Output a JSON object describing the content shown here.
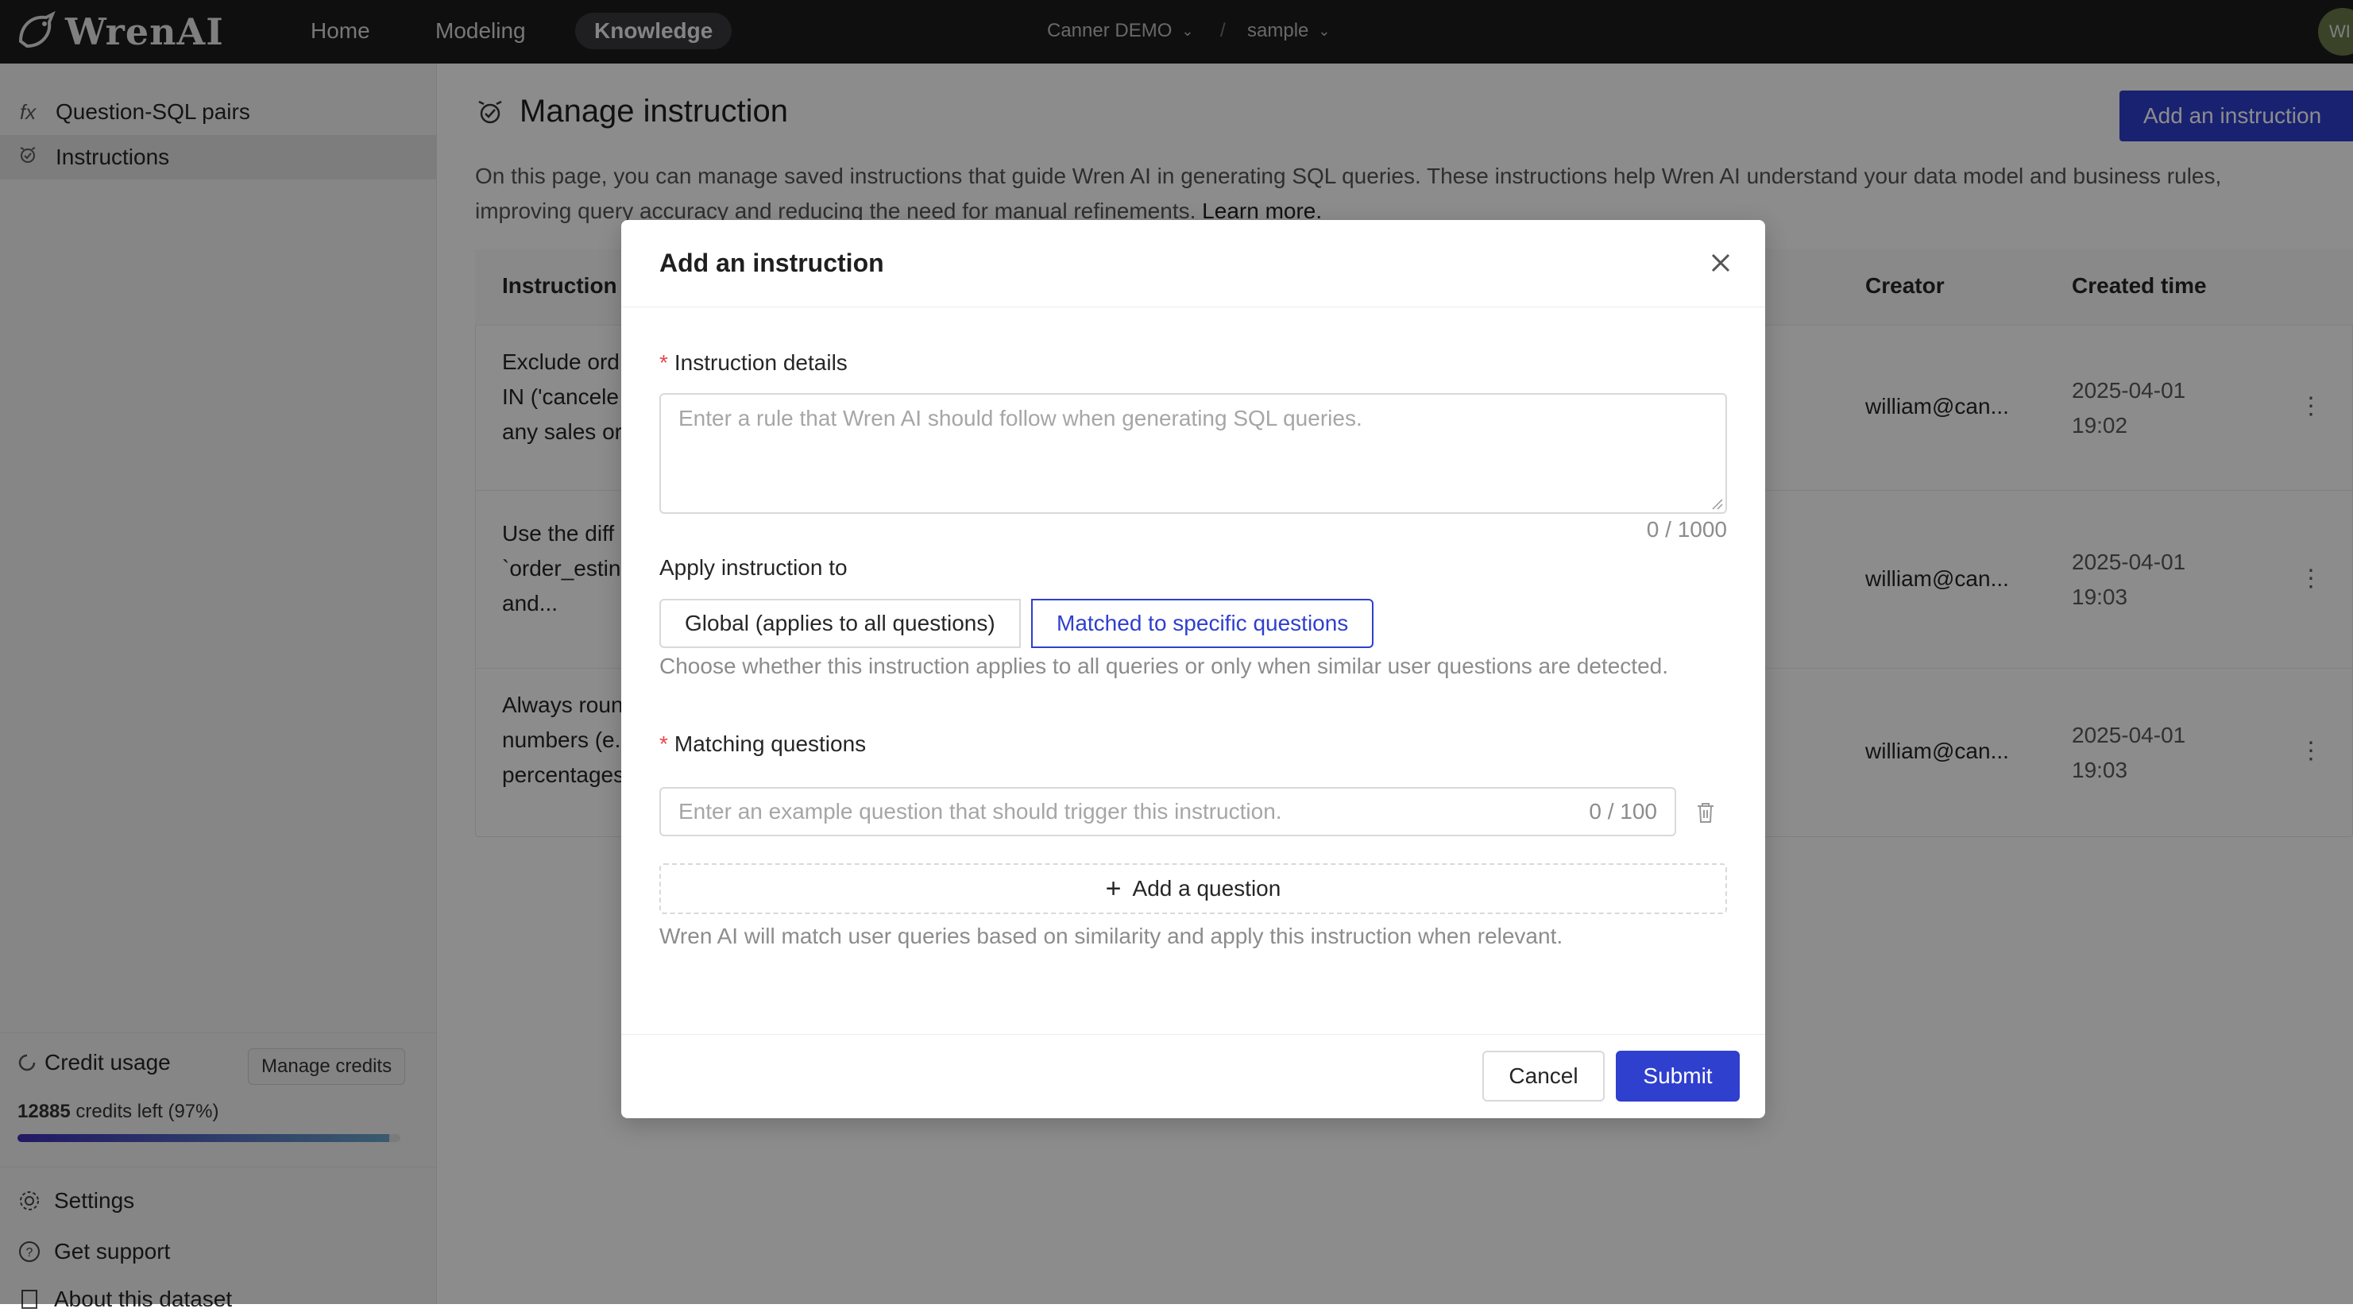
{
  "app": {
    "logo_text": "WrenAI"
  },
  "topnav": {
    "items": [
      "Home",
      "Modeling",
      "Knowledge"
    ],
    "active": "Knowledge",
    "project": "Canner DEMO",
    "separator": "/",
    "dataset": "sample",
    "avatar_initials": "WI"
  },
  "sidebar": {
    "items": [
      {
        "label": "Question-SQL pairs",
        "icon": "fx"
      },
      {
        "label": "Instructions",
        "icon": "instruction-icon"
      }
    ],
    "credit": {
      "title": "Credit usage",
      "manage_button": "Manage credits",
      "credits_number": "12885",
      "credits_text": "credits left (97%)",
      "progress_percent": 97
    },
    "bottom_items": [
      {
        "label": "Settings",
        "icon": "gear-icon"
      },
      {
        "label": "Get support",
        "icon": "help-icon"
      },
      {
        "label": "About this dataset",
        "icon": "book-icon"
      }
    ]
  },
  "main": {
    "title": "Manage instruction",
    "add_button": "Add an instruction",
    "description": "On this page, you can manage saved instructions that guide Wren AI in generating SQL queries. These instructions help Wren AI understand your data model and business rules, improving query accuracy and reducing the need for manual refinements.",
    "learn_more": "Learn more.",
    "table": {
      "headers": {
        "instruction": "Instruction",
        "creator": "Creator",
        "created_time": "Created time"
      },
      "rows": [
        {
          "text": [
            "Exclude ord",
            "IN ('cancele",
            "any sales or"
          ],
          "creator": "william@can...",
          "date": "2025-04-01",
          "time": "19:02"
        },
        {
          "text": [
            "Use the diff",
            "`order_estin",
            "and..."
          ],
          "creator": "william@can...",
          "date": "2025-04-01",
          "time": "19:03"
        },
        {
          "text": [
            "Always roun",
            "numbers (e.",
            "percentages"
          ],
          "creator": "william@can...",
          "date": "2025-04-01",
          "time": "19:03"
        }
      ]
    }
  },
  "modal": {
    "title": "Add an instruction",
    "details_label": "Instruction details",
    "details_placeholder": "Enter a rule that Wren AI should follow when generating SQL queries.",
    "details_count": "0 / 1000",
    "apply_label": "Apply instruction to",
    "option_global": "Global (applies to all questions)",
    "option_matched": "Matched to specific questions",
    "apply_helper": "Choose whether this instruction applies to all queries or only when similar user questions are detected.",
    "matching_label": "Matching questions",
    "question_placeholder": "Enter an example question that should trigger this instruction.",
    "question_count": "0 / 100",
    "add_question": "Add a question",
    "matching_helper": "Wren AI will match user queries based on similarity and apply this instruction when relevant.",
    "cancel": "Cancel",
    "submit": "Submit"
  },
  "colors": {
    "primary": "#2f3fce",
    "topbar": "#1c1c1e",
    "required": "#e5484d"
  }
}
